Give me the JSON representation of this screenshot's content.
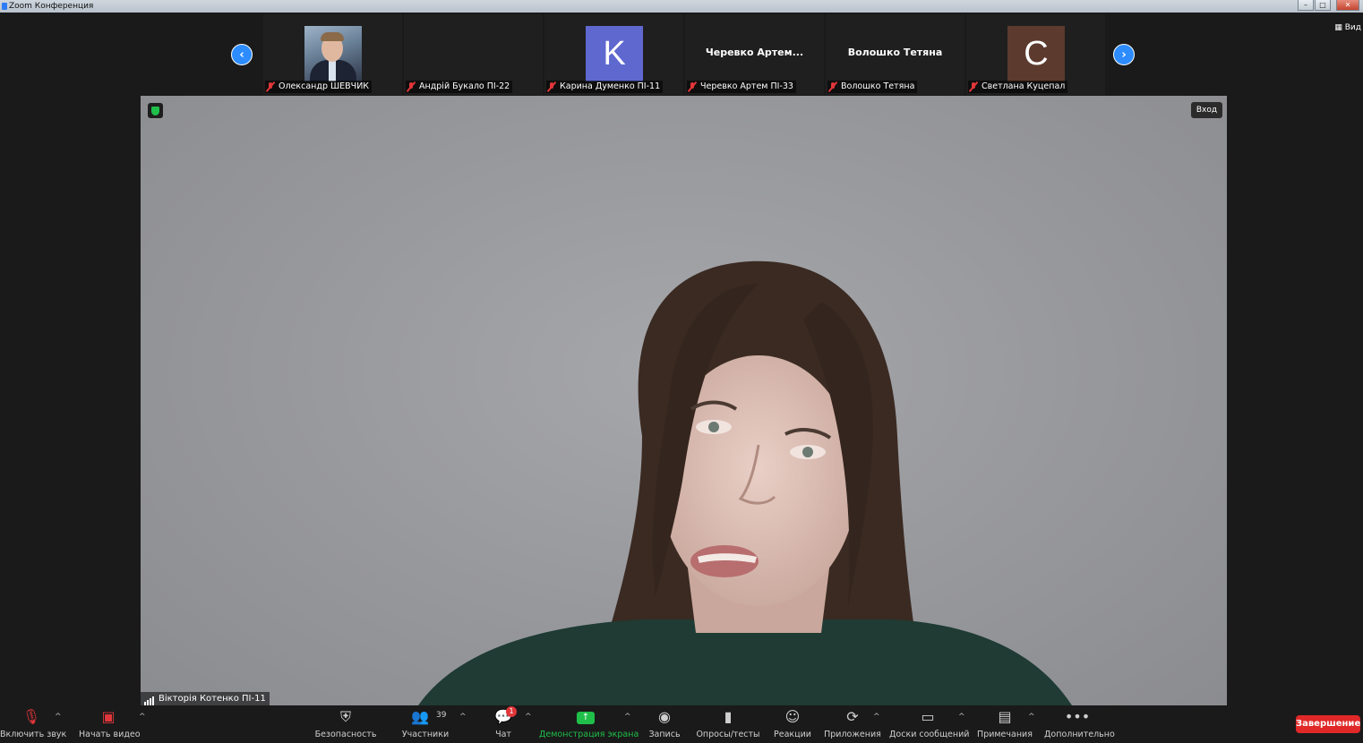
{
  "window": {
    "title": "Zoom Конференция",
    "view_label": "Вид"
  },
  "participants": [
    {
      "name": "Олександр ШЕВЧИК",
      "type": "photo"
    },
    {
      "name": "Андрій Букало ПІ-22",
      "type": "blank"
    },
    {
      "name": "Карина Думенко ПІ-11",
      "type": "avatar",
      "initial": "K",
      "color": "#5f68cf"
    },
    {
      "name": "Черевко Артем ПІ-33",
      "type": "text",
      "display": "Черевко  Артем..."
    },
    {
      "name": "Волошко Тетяна",
      "type": "text",
      "display": "Волошко Тетяна"
    },
    {
      "name": "Светлана Куцепал",
      "type": "avatar",
      "initial": "C",
      "color": "#5c3a2e"
    }
  ],
  "main_video": {
    "speaker": "Вікторія Котенко ПІ-11",
    "enter_label": "Вход"
  },
  "toolbar": {
    "unmute": "Включить звук",
    "start_video": "Начать видео",
    "security": "Безопасность",
    "participants": "Участники",
    "participants_count": "39",
    "chat": "Чат",
    "chat_badge": "1",
    "share_screen": "Демонстрация экрана",
    "record": "Запись",
    "polls": "Опросы/тесты",
    "reactions": "Реакции",
    "apps": "Приложения",
    "whiteboards": "Доски сообщений",
    "notes": "Примечания",
    "more": "Дополнительно",
    "end": "Завершение"
  },
  "colors": {
    "accent": "#2d8cff",
    "end": "#e02828",
    "share": "#1fbf4a",
    "muted": "#e0363a"
  }
}
